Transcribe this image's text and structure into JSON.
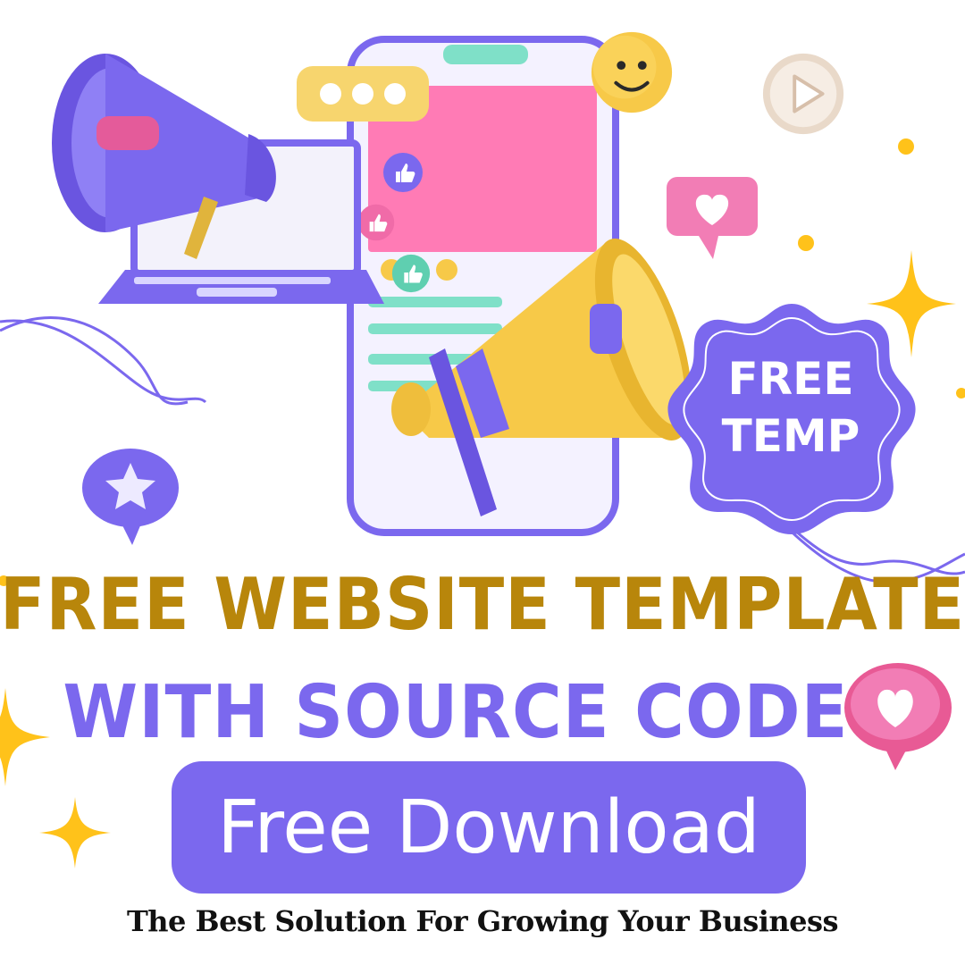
{
  "headline": {
    "line1": "FREE WEBSITE TEMPLATE",
    "line2": "WITH SOURCE CODE"
  },
  "cta": {
    "label": "Free Download"
  },
  "tagline": "The Best Solution For Growing Your Business",
  "badge": {
    "line1": "FREE",
    "line2": "TEMP"
  },
  "colors": {
    "gold": "#B8860B",
    "purple": "#7B68EE",
    "pink": "#FF7BB5",
    "yellow": "#F7C948",
    "mint": "#7FE0C8",
    "spark": "#FFC21A"
  },
  "icons": [
    "megaphone-purple-icon",
    "megaphone-yellow-icon",
    "laptop-icon",
    "phone-mockup-icon",
    "smiley-icon",
    "play-icon",
    "heart-icon",
    "star-icon",
    "thumbs-up-icon",
    "sparkle-icon"
  ]
}
